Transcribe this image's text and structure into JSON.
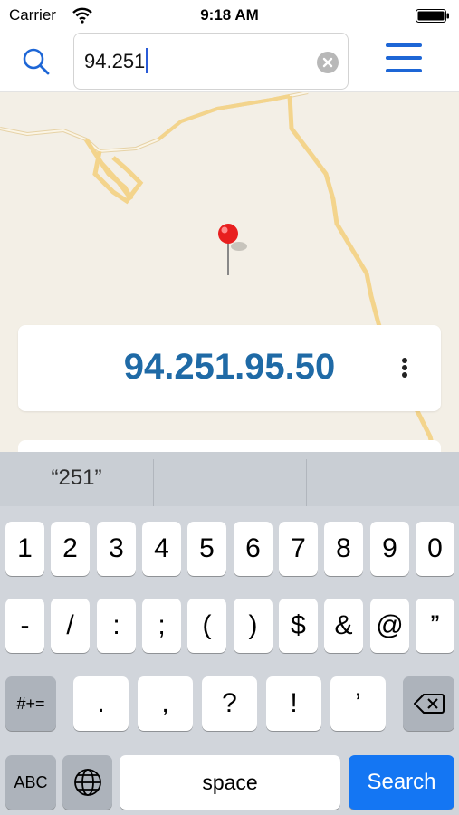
{
  "status_bar": {
    "carrier": "Carrier",
    "time": "9:18 AM"
  },
  "search": {
    "value": "94.251"
  },
  "result": {
    "ip": "94.251.95.50"
  },
  "suggestions": [
    "“251”",
    "",
    ""
  ],
  "keyboard": {
    "row1": [
      "1",
      "2",
      "3",
      "4",
      "5",
      "6",
      "7",
      "8",
      "9",
      "0"
    ],
    "row2": [
      "-",
      "/",
      ":",
      ";",
      "(",
      ")",
      "$",
      "&",
      "@",
      "”"
    ],
    "row3_toggle": "#+=",
    "row3": [
      ".",
      ",",
      "?",
      "!",
      "’"
    ],
    "abc_label": "ABC",
    "space_label": "space",
    "search_label": "Search"
  },
  "colors": {
    "accent": "#1d66d6",
    "ip_text": "#1f6aa6",
    "search_key": "#1476f3",
    "map_bg": "#f3efe6",
    "road": "#f5d68a"
  },
  "icons": [
    "wifi-icon",
    "battery-icon",
    "search-icon",
    "clear-icon",
    "menu-icon",
    "map-pin-icon",
    "more-vertical-icon",
    "globe-icon",
    "backspace-icon"
  ]
}
